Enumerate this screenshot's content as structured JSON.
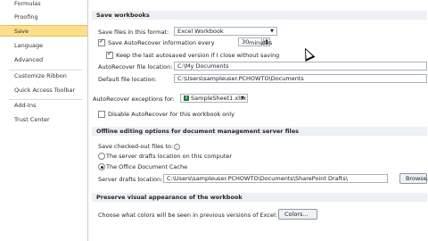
{
  "sidebar": {
    "items": [
      {
        "label": "Formulas"
      },
      {
        "label": "Proofing"
      },
      {
        "label": "Save"
      },
      {
        "label": "Language"
      },
      {
        "label": "Advanced"
      },
      {
        "label": "Customize Ribbon"
      },
      {
        "label": "Quick Access Toolbar"
      },
      {
        "label": "Add-Ins"
      },
      {
        "label": "Trust Center"
      }
    ]
  },
  "save_workbooks": {
    "header": "Save workbooks",
    "format_label": "Save files in this format:",
    "format_value": "Excel Workbook",
    "autorecover_label": "Save AutoRecover information every",
    "autorecover_minutes": "30",
    "minutes_label": "minutes",
    "keep_last_label": "Keep the last autosaved version if I close without saving",
    "autorecover_location_label": "AutoRecover file location:",
    "autorecover_location_value": "C:\\My Documents",
    "default_location_label": "Default file location:",
    "default_location_value": "C:\\Users\\sampleuser.PCHOWTO\\Documents"
  },
  "autorecover_exceptions": {
    "label": "AutoRecover exceptions for:",
    "workbook": "SampleSheet1.xlsx",
    "disable_label": "Disable AutoRecover for this workbook only"
  },
  "offline": {
    "header": "Offline editing options for document management server files",
    "save_checked_out_label": "Save checked-out files to:",
    "option_server": "The server drafts location on this computer",
    "option_cache": "The Office Document Cache",
    "drafts_label": "Server drafts location:",
    "drafts_value": "C:\\Users\\sampleuser.PCHOWTO\\Documents\\SharePoint Drafts\\",
    "browse_label": "Browse..."
  },
  "preserve": {
    "header": "Preserve visual appearance of the workbook",
    "colors_question": "Choose what colors will be seen in previous versions of Excel:",
    "colors_button": "Colors..."
  }
}
